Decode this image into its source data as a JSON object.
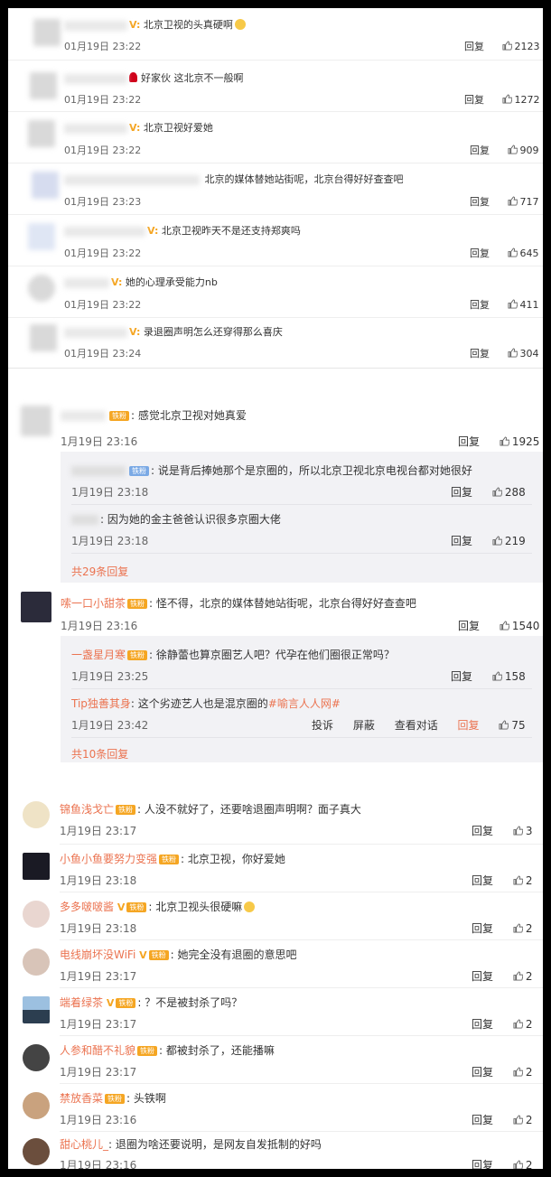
{
  "top": [
    {
      "text": "北京卫视的头真硬啊",
      "time": "01月19日 23:22",
      "reply": "回复",
      "likes": "2123",
      "vip": "V:",
      "emoji": true
    },
    {
      "text": "好家伙 这北京不一般啊",
      "time": "01月19日 23:22",
      "reply": "回复",
      "likes": "1272",
      "vip": "",
      "rose": true
    },
    {
      "text": "北京卫视好爱她",
      "time": "01月19日 23:22",
      "reply": "回复",
      "likes": "909",
      "vip": "V:"
    },
    {
      "text": "北京的媒体替她站街呢，北京台得好好查查吧",
      "time": "01月19日 23:23",
      "reply": "回复",
      "likes": "717",
      "vip": ""
    },
    {
      "text": "北京卫视昨天不是还支持郑爽吗",
      "time": "01月19日 23:22",
      "reply": "回复",
      "likes": "645",
      "vip": "V:"
    },
    {
      "text": "她的心理承受能力nb",
      "time": "01月19日 23:22",
      "reply": "回复",
      "likes": "411",
      "vip": "V:"
    },
    {
      "text": "录退圈声明怎么还穿得那么喜庆",
      "time": "01月19日 23:24",
      "reply": "回复",
      "likes": "304",
      "vip": "V:"
    }
  ],
  "thread1": {
    "main": {
      "fan": "铁粉",
      "text": "感觉北京卫视对她真爱",
      "time": "1月19日 23:16",
      "reply": "回复",
      "likes": "1925"
    },
    "replies": [
      {
        "fan": "铁粉",
        "text": "说是背后捧她那个是京圈的，所以北京卫视北京电视台都对她很好",
        "time": "1月19日 23:18",
        "reply": "回复",
        "likes": "288"
      },
      {
        "text": "因为她的金主爸爸认识很多京圈大佬",
        "time": "1月19日 23:18",
        "reply": "回复",
        "likes": "219"
      }
    ],
    "more": "共29条回复"
  },
  "thread2": {
    "main": {
      "name": "嗦一口小甜茶",
      "fan": "铁粉",
      "text": "怪不得，北京的媒体替她站街呢，北京台得好好查查吧",
      "time": "1月19日 23:16",
      "reply": "回复",
      "likes": "1540"
    },
    "replies": [
      {
        "name": "一盏星月寒",
        "fan": "铁粉",
        "text": "徐静蕾也算京圈艺人吧？代孕在他们圈很正常吗？",
        "time": "1月19日 23:25",
        "reply": "回复",
        "likes": "158"
      },
      {
        "name": "Tip独善其身",
        "text": "这个劣迹艺人也是混京圈的",
        "tag": "#喻言人人网#",
        "time": "1月19日 23:42",
        "report": "投诉",
        "block": "屏蔽",
        "view": "查看对话",
        "reply": "回复",
        "likes": "75"
      }
    ],
    "more": "共10条回复"
  },
  "bottom": [
    {
      "name": "锦鱼浅戈亡",
      "fan": "铁粉",
      "text": "人没不就好了，还要啥退圈声明啊？面子真大",
      "time": "1月19日 23:17",
      "reply": "回复",
      "likes": "3"
    },
    {
      "name": "小鱼小鱼要努力变强",
      "fan": "铁粉",
      "text": "北京卫视，你好爱她",
      "time": "1月19日 23:18",
      "reply": "回复",
      "likes": "2"
    },
    {
      "name": "多多啵啵酱",
      "vip": "V",
      "fan": "铁粉",
      "text": "北京卫视头很硬嘛",
      "time": "1月19日 23:18",
      "reply": "回复",
      "likes": "2",
      "emoji": true
    },
    {
      "name": "电线崩坏没WiFi",
      "vip": "V",
      "fan": "铁粉",
      "text": "她完全没有退圈的意思吧",
      "time": "1月19日 23:17",
      "reply": "回复",
      "likes": "2"
    },
    {
      "name": "端着绿茶",
      "vip": "V",
      "fan": "铁粉",
      "text": "？不是被封杀了吗？",
      "time": "1月19日 23:17",
      "reply": "回复",
      "likes": "2"
    },
    {
      "name": "人参和醋不礼貌",
      "fan": "铁粉",
      "text": "都被封杀了，还能播嘛",
      "time": "1月19日 23:17",
      "reply": "回复",
      "likes": "2"
    },
    {
      "name": "禁放香菜",
      "fan": "铁粉",
      "text": "头铁啊",
      "time": "1月19日 23:16",
      "reply": "回复",
      "likes": "2"
    },
    {
      "name": "甜心桃儿_",
      "text": "退圈为啥还要说明，是网友自发抵制的好吗",
      "time": "1月19日 23:16",
      "reply": "回复",
      "likes": "2"
    }
  ],
  "colors": {
    "accent": "#eb7350",
    "vip": "#f5a623",
    "fan_badge": "#f5a623"
  }
}
